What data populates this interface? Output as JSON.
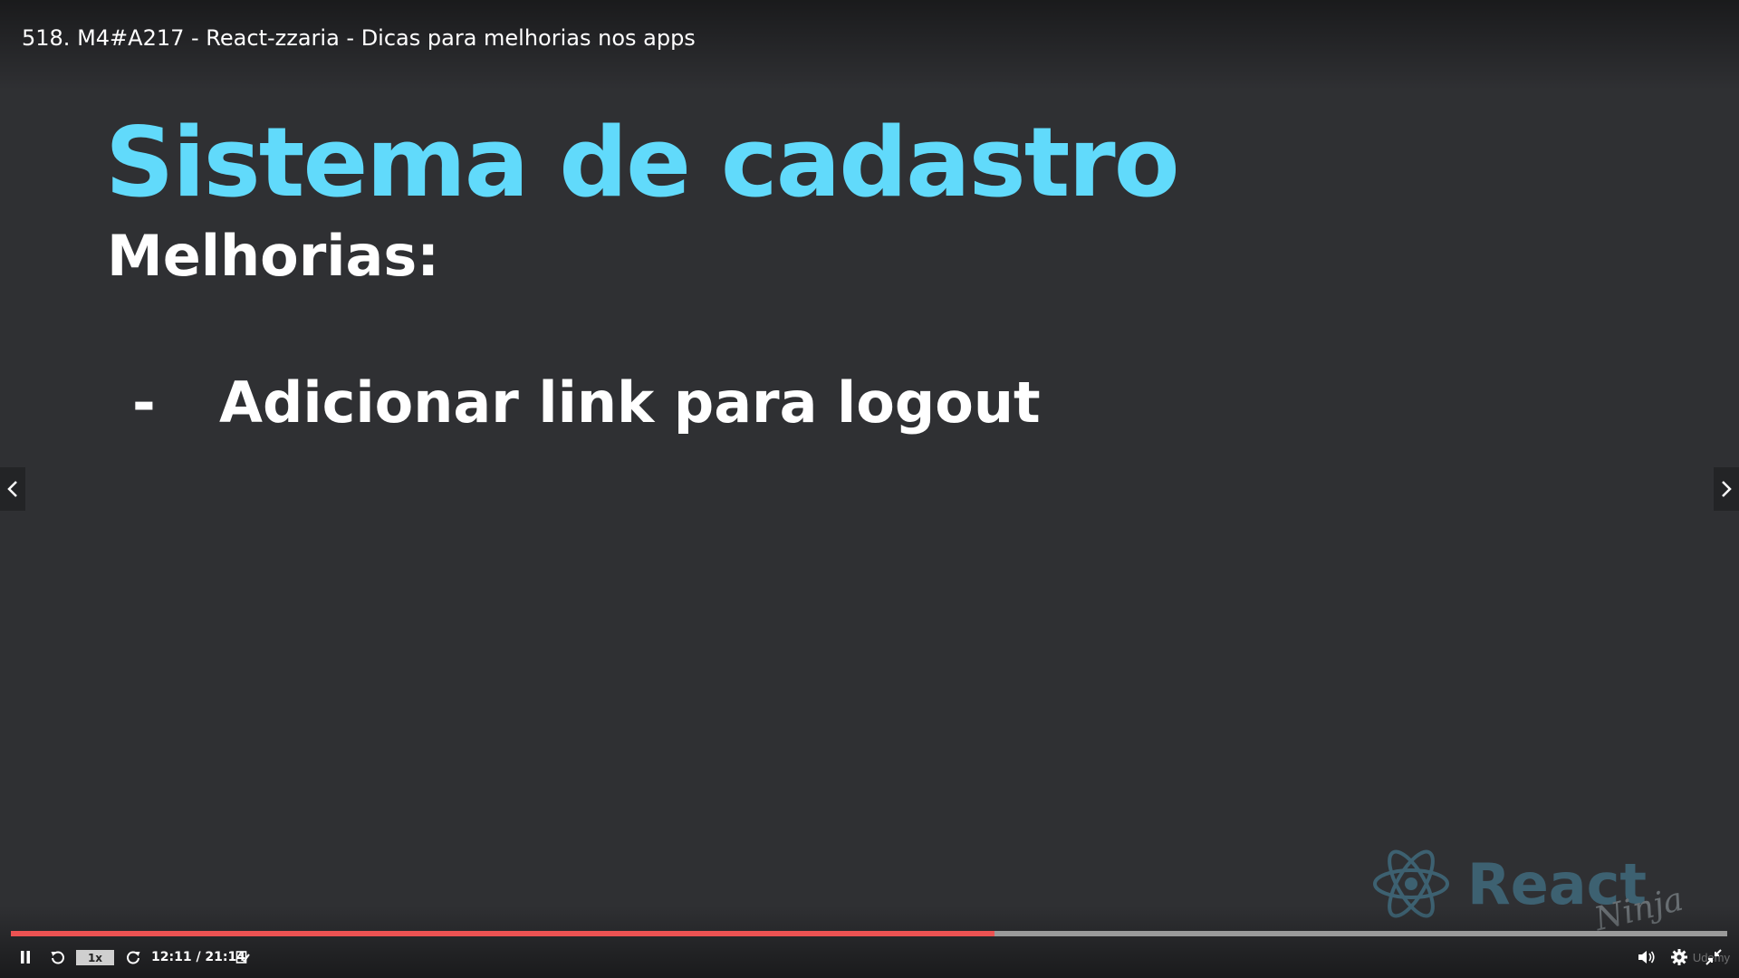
{
  "video": {
    "title": "518. M4#A217 - React-zzaria - Dicas para melhorias nos apps"
  },
  "slide": {
    "title": "Sistema de cadastro",
    "subtitle": "Melhorias:",
    "bullets": [
      {
        "marker": "-",
        "text": "Adicionar link para logout"
      }
    ]
  },
  "watermark": {
    "logo_text": "React",
    "logo_script": "Ninja"
  },
  "player": {
    "speed": "1x",
    "time_current": "12:11",
    "time_total": "21:14",
    "time_display": "12:11 / 21:14",
    "progress": 0.573,
    "brand": "Udemy"
  },
  "colors": {
    "background": "#2f3033",
    "slide_title": "#61dafb",
    "progress_played": "#ec5252",
    "progress_track": "#9a9a9a"
  },
  "icons": {
    "pause": "pause-icon",
    "rewind": "rewind-icon",
    "forward": "forward-icon",
    "notes": "notes-icon",
    "volume": "volume-icon",
    "settings": "gear-icon",
    "fullscreen": "fullscreen-exit-icon",
    "prev": "chevron-left-icon",
    "next": "chevron-right-icon",
    "logo": "react-atom-icon"
  }
}
